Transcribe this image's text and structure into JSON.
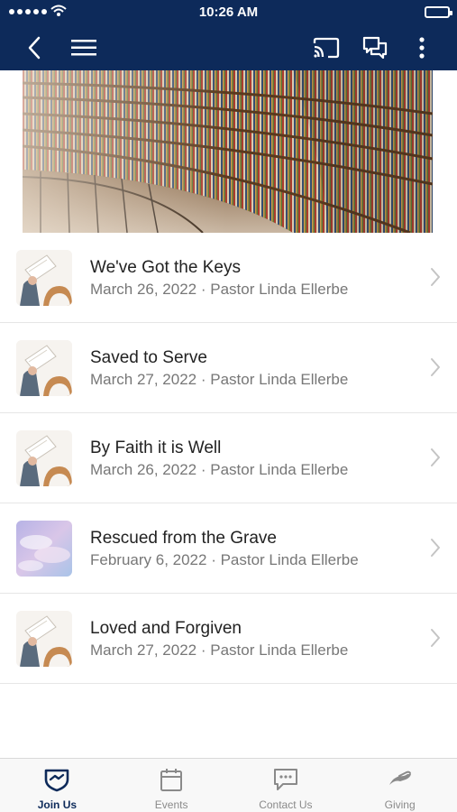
{
  "status_bar": {
    "time": "10:26 AM"
  },
  "nav": {
    "back_icon": "chevron-left-icon",
    "menu_icon": "hamburger-icon",
    "cast_icon": "cast-icon",
    "chat_icon": "chat-icon",
    "more_icon": "more-vertical-icon"
  },
  "colors": {
    "nav_bg": "#0d2a5a",
    "accent": "#0d2a5a",
    "inactive": "#8a8a8a"
  },
  "sermons": [
    {
      "title": "We've Got the Keys",
      "subtitle": "March 26, 2022 · Pastor Linda Ellerbe",
      "thumb": "book-hat"
    },
    {
      "title": "Saved to Serve",
      "subtitle": "March 27, 2022 · Pastor Linda Ellerbe",
      "thumb": "book-hat"
    },
    {
      "title": "By Faith it is Well",
      "subtitle": "March 26, 2022 · Pastor Linda Ellerbe",
      "thumb": "book-hat"
    },
    {
      "title": "Rescued from the Grave",
      "subtitle": "February 6, 2022 · Pastor Linda Ellerbe",
      "thumb": "sky"
    },
    {
      "title": "Loved and Forgiven",
      "subtitle": "March 27, 2022 · Pastor Linda Ellerbe",
      "thumb": "book-hat"
    }
  ],
  "tabs": [
    {
      "label": "Join Us",
      "icon": "join-us-icon",
      "active": true
    },
    {
      "label": "Events",
      "icon": "calendar-icon",
      "active": false
    },
    {
      "label": "Contact Us",
      "icon": "message-icon",
      "active": false
    },
    {
      "label": "Giving",
      "icon": "giving-icon",
      "active": false
    }
  ]
}
